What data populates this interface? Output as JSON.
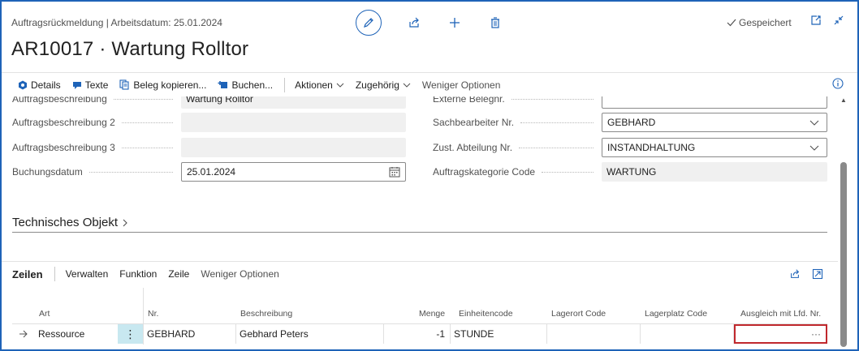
{
  "header": {
    "breadcrumb": "Auftragsrückmeldung | Arbeitsdatum: 25.01.2024",
    "title": "AR10017 · Wartung Rolltor",
    "saved_status": "Gespeichert"
  },
  "actionbar": {
    "details": "Details",
    "texte": "Texte",
    "beleg_kopieren": "Beleg kopieren...",
    "buchen": "Buchen...",
    "aktionen": "Aktionen",
    "zugehoerig": "Zugehörig",
    "weniger": "Weniger Optionen"
  },
  "form": {
    "left": [
      {
        "label": "Auftragsbeschreibung",
        "value": "Wartung Rolltor"
      },
      {
        "label": "Auftragsbeschreibung 2",
        "value": ""
      },
      {
        "label": "Auftragsbeschreibung 3",
        "value": ""
      },
      {
        "label": "Buchungsdatum",
        "value": "25.01.2024"
      }
    ],
    "right": [
      {
        "label": "Externe Belegnr.",
        "value": ""
      },
      {
        "label": "Sachbearbeiter Nr.",
        "value": "GEBHARD"
      },
      {
        "label": "Zust. Abteilung Nr.",
        "value": "INSTANDHALTUNG"
      },
      {
        "label": "Auftragskategorie Code",
        "value": "WARTUNG"
      }
    ]
  },
  "section": {
    "technical_object": "Technisches Objekt"
  },
  "lines": {
    "title": "Zeilen",
    "actions": [
      "Verwalten",
      "Funktion",
      "Zeile",
      "Weniger Optionen"
    ],
    "columns": {
      "art": "Art",
      "nr": "Nr.",
      "beschreibung": "Beschreibung",
      "menge": "Menge",
      "einheitencode": "Einheitencode",
      "lagerort": "Lagerort Code",
      "lagerplatz": "Lagerplatz Code",
      "ausgleich": "Ausgleich mit Lfd. Nr."
    },
    "rows": [
      {
        "art": "Ressource",
        "nr": "GEBHARD",
        "beschreibung": "Gebhard Peters",
        "menge": "-1",
        "einheitencode": "STUNDE",
        "lagerort": "",
        "lagerplatz": "",
        "ausgleich": "···"
      }
    ]
  },
  "icons": {
    "edit": "pencil-icon",
    "share": "share-icon",
    "new": "plus-icon",
    "delete": "trash-icon",
    "saved": "check-icon",
    "popout": "popout-icon",
    "collapse": "collapse-icon",
    "info": "info-icon"
  },
  "colors": {
    "accent": "#1e63b8",
    "focus_border": "#c0282d",
    "row_menu_bg": "#c8e8f0"
  }
}
